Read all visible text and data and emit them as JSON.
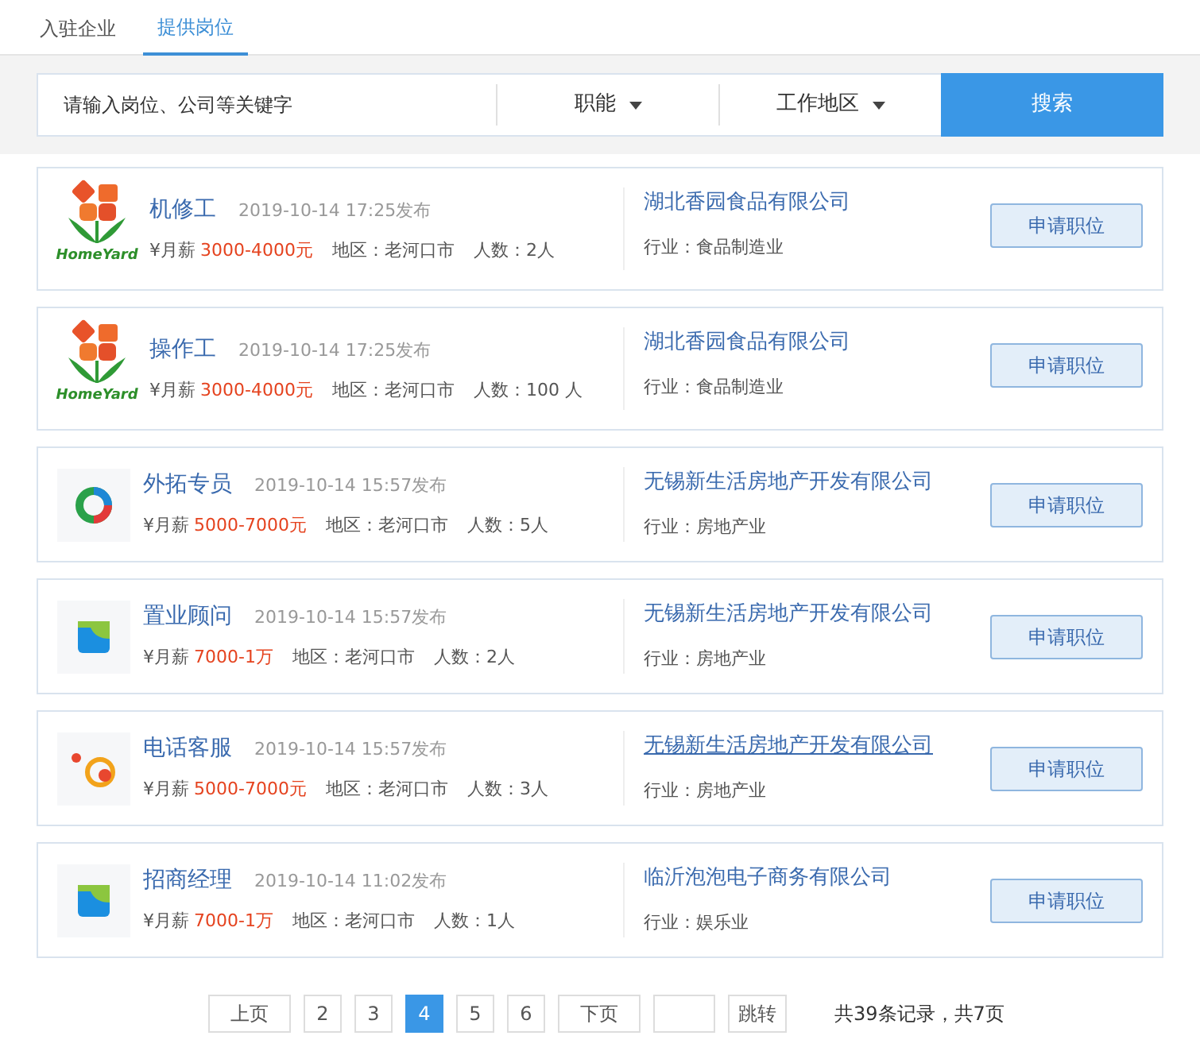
{
  "tabs": [
    {
      "label": "入驻企业",
      "selected": false
    },
    {
      "label": "提供岗位",
      "selected": true
    }
  ],
  "search": {
    "placeholder": "请输入岗位、公司等关键字",
    "filters": [
      "职能",
      "工作地区"
    ],
    "button": "搜索"
  },
  "jobs": [
    {
      "logo": {
        "kind": "homeyard",
        "text": "HomeYard"
      },
      "title": "机修工",
      "posted": "2019-10-14 17:25发布",
      "salary_label": "¥月薪",
      "salary": "3000-4000元",
      "region": "地区：老河口市",
      "headcount": "人数：2人",
      "company": "湖北香园食品有限公司",
      "company_underlined": false,
      "industry": "行业：食品制造业",
      "apply": "申请职位"
    },
    {
      "logo": {
        "kind": "homeyard",
        "text": "HomeYard"
      },
      "title": "操作工",
      "posted": "2019-10-14 17:25发布",
      "salary_label": "¥月薪",
      "salary": "3000-4000元",
      "region": "地区：老河口市",
      "headcount": "人数：100 人",
      "company": "湖北香园食品有限公司",
      "company_underlined": false,
      "industry": "行业：食品制造业",
      "apply": "申请职位"
    },
    {
      "logo": {
        "kind": "ring"
      },
      "title": "外拓专员",
      "posted": "2019-10-14 15:57发布",
      "salary_label": "¥月薪",
      "salary": "5000-7000元",
      "region": "地区：老河口市",
      "headcount": "人数：5人",
      "company": "无锡新生活房地产开发有限公司",
      "company_underlined": false,
      "industry": "行业：房地产业",
      "apply": "申请职位"
    },
    {
      "logo": {
        "kind": "square"
      },
      "title": "置业顾问",
      "posted": "2019-10-14 15:57发布",
      "salary_label": "¥月薪",
      "salary": "7000-1万",
      "region": "地区：老河口市",
      "headcount": "人数：2人",
      "company": "无锡新生活房地产开发有限公司",
      "company_underlined": false,
      "industry": "行业：房地产业",
      "apply": "申请职位"
    },
    {
      "logo": {
        "kind": "dots"
      },
      "title": "电话客服",
      "posted": "2019-10-14 15:57发布",
      "salary_label": "¥月薪",
      "salary": "5000-7000元",
      "region": "地区：老河口市",
      "headcount": "人数：3人",
      "company": "无锡新生活房地产开发有限公司",
      "company_underlined": true,
      "industry": "行业：房地产业",
      "apply": "申请职位"
    },
    {
      "logo": {
        "kind": "square"
      },
      "title": "招商经理",
      "posted": "2019-10-14 11:02发布",
      "salary_label": "¥月薪",
      "salary": "7000-1万",
      "region": "地区：老河口市",
      "headcount": "人数：1人",
      "company": "临沂泡泡电子商务有限公司",
      "company_underlined": false,
      "industry": "行业：娱乐业",
      "apply": "申请职位"
    }
  ],
  "pagination": {
    "prev": "上页",
    "pages": [
      {
        "label": "2",
        "selected": false
      },
      {
        "label": "3",
        "selected": false
      },
      {
        "label": "4",
        "selected": true
      },
      {
        "label": "5",
        "selected": false
      },
      {
        "label": "6",
        "selected": false
      }
    ],
    "next": "下页",
    "jump": "跳转",
    "summary": "共39条记录，共7页"
  }
}
